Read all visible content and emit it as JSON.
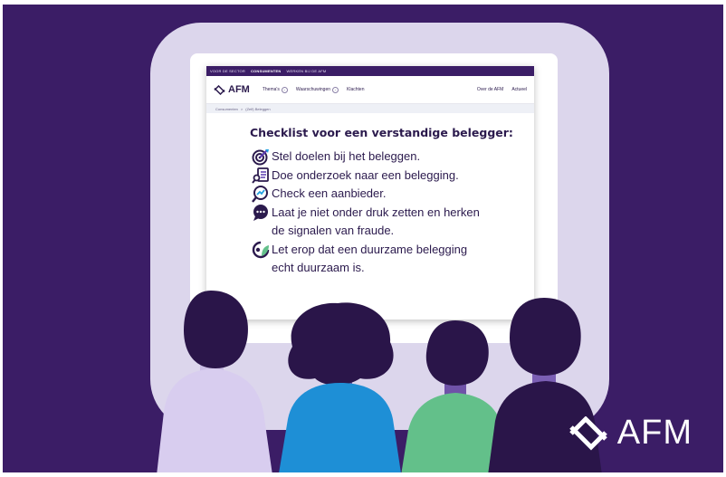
{
  "browser": {
    "topnav": [
      "VOOR DE SECTOR",
      "CONSUMENTEN",
      "WERKEN BIJ DE AFM"
    ],
    "logo_text": "AFM",
    "menu": {
      "themas": "Thema's",
      "waarschuwingen": "Waarschuwingen",
      "klachten": "Klachten",
      "over": "Over de AFM",
      "actueel": "Actueel"
    },
    "breadcrumb": [
      "Consumenten",
      ">",
      "(Zelf) Beleggen"
    ]
  },
  "checklist": {
    "title": "Checklist voor een verstandige belegger:",
    "line1": "Stel doelen bij het beleggen.",
    "line2": "Doe onderzoek naar een belegging.",
    "line3": "Check een aanbieder.",
    "line4a": "Laat je niet onder druk zetten en herken",
    "line4b": "de signalen van fraude.",
    "line5a": "Let erop dat een duurzame belegging",
    "line5b": "echt duurzaam is."
  },
  "brand_logo_text": "AFM",
  "colors": {
    "background": "#3b1d66",
    "frame": "#dcd6ec",
    "text": "#2b1a4d",
    "person_lavender": "#d8cdef",
    "person_blue": "#1e8fd6",
    "person_green": "#63c08a",
    "person_dark": "#2a1549"
  }
}
